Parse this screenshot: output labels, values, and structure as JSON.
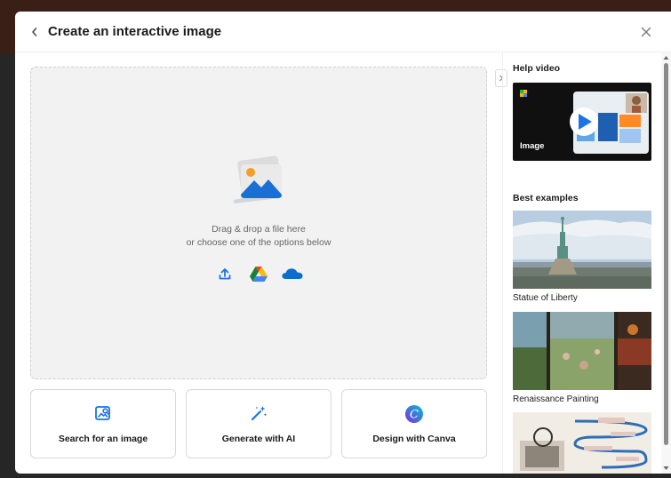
{
  "dialog": {
    "title": "Create an interactive image"
  },
  "dropzone": {
    "line1": "Drag & drop a file here",
    "line2": "or choose one of the options below",
    "sources": [
      "upload-icon",
      "google-drive-icon",
      "onedrive-icon"
    ]
  },
  "options": [
    {
      "label": "Search for an image",
      "icon": "image-search-icon"
    },
    {
      "label": "Generate with AI",
      "icon": "magic-wand-icon"
    },
    {
      "label": "Design with Canva",
      "icon": "canva-icon"
    }
  ],
  "side_panel": {
    "help_title": "Help video",
    "video_label": "Image",
    "examples_title": "Best examples",
    "examples": [
      {
        "caption": "Statue of Liberty"
      },
      {
        "caption": "Renaissance Painting"
      }
    ]
  },
  "colors": {
    "accent": "#1a73e8",
    "onedrive": "#0a6ed1",
    "canva": "#5b3ff0"
  }
}
